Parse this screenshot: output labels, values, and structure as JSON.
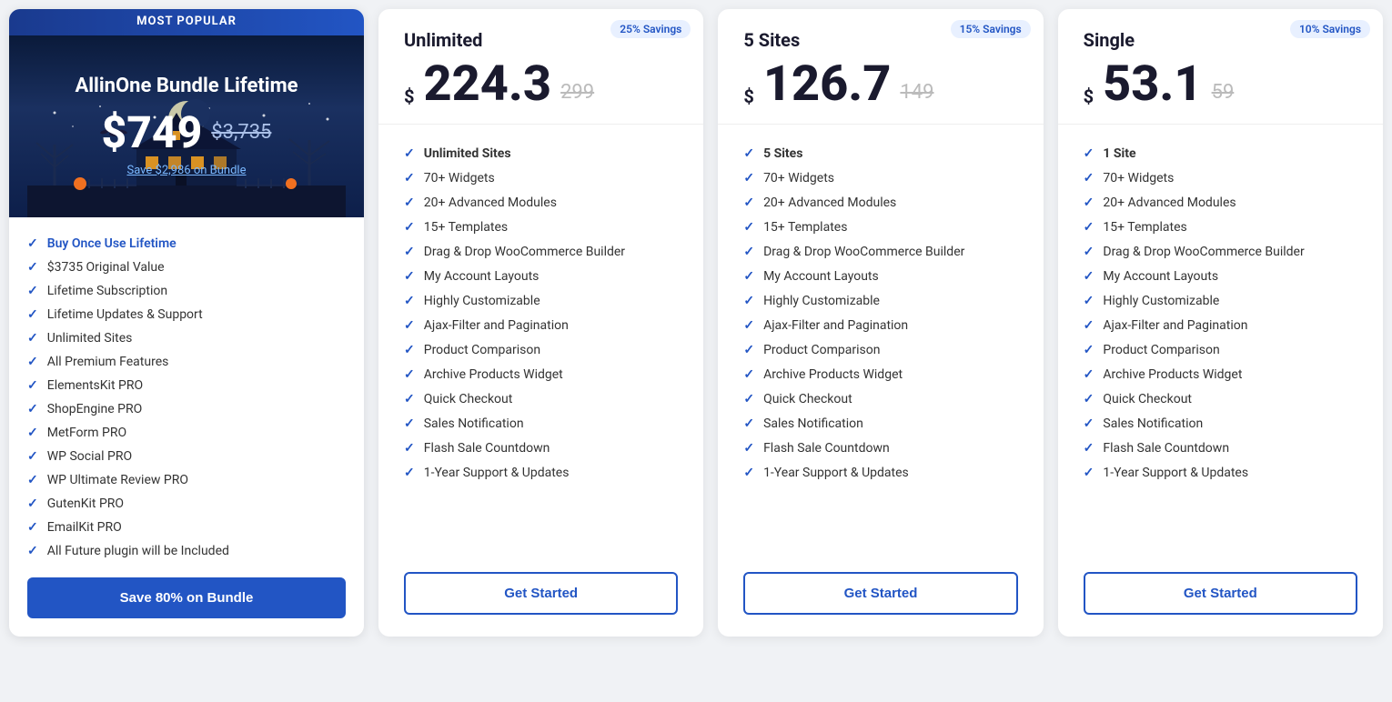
{
  "bundle": {
    "badge": "MOST POPULAR",
    "title": "AllinOne Bundle Lifetime",
    "price": "$749",
    "original_price": "$3,735",
    "save_text": "Save $2,986 on Bundle",
    "features": [
      {
        "text": "Buy Once Use Lifetime",
        "highlight": true
      },
      {
        "text": "$3735 Original Value",
        "highlight": false
      },
      {
        "text": "Lifetime Subscription",
        "highlight": false
      },
      {
        "text": "Lifetime Updates & Support",
        "highlight": false
      },
      {
        "text": "Unlimited Sites",
        "highlight": false
      },
      {
        "text": "All Premium Features",
        "highlight": false
      },
      {
        "text": "ElementsKit PRO",
        "highlight": false
      },
      {
        "text": "ShopEngine PRO",
        "highlight": false
      },
      {
        "text": "MetForm PRO",
        "highlight": false
      },
      {
        "text": "WP Social PRO",
        "highlight": false
      },
      {
        "text": "WP Ultimate Review PRO",
        "highlight": false
      },
      {
        "text": "GutenKit PRO",
        "highlight": false
      },
      {
        "text": "EmailKit PRO",
        "highlight": false
      },
      {
        "text": "All Future plugin will be Included",
        "highlight": false
      }
    ],
    "button_label": "Save 80% on Bundle"
  },
  "plans": [
    {
      "id": "unlimited",
      "savings_badge": "25% Savings",
      "name": "Unlimited",
      "price_dollar": "$",
      "price": "224.3",
      "original_price": "299",
      "features": [
        {
          "text": "Unlimited Sites",
          "bold": true
        },
        {
          "text": "70+ Widgets",
          "bold": false
        },
        {
          "text": "20+ Advanced Modules",
          "bold": false
        },
        {
          "text": "15+ Templates",
          "bold": false
        },
        {
          "text": "Drag & Drop WooCommerce Builder",
          "bold": false
        },
        {
          "text": "My Account Layouts",
          "bold": false
        },
        {
          "text": "Highly Customizable",
          "bold": false
        },
        {
          "text": "Ajax-Filter and Pagination",
          "bold": false
        },
        {
          "text": "Product Comparison",
          "bold": false
        },
        {
          "text": "Archive Products Widget",
          "bold": false
        },
        {
          "text": "Quick Checkout",
          "bold": false
        },
        {
          "text": "Sales Notification",
          "bold": false
        },
        {
          "text": "Flash Sale Countdown",
          "bold": false
        },
        {
          "text": "1-Year Support & Updates",
          "bold": false
        }
      ],
      "button_label": "Get Started"
    },
    {
      "id": "five-sites",
      "savings_badge": "15% Savings",
      "name": "5 Sites",
      "price_dollar": "$",
      "price": "126.7",
      "original_price": "149",
      "features": [
        {
          "text": "5 Sites",
          "bold": true
        },
        {
          "text": "70+ Widgets",
          "bold": false
        },
        {
          "text": "20+ Advanced Modules",
          "bold": false
        },
        {
          "text": "15+ Templates",
          "bold": false
        },
        {
          "text": "Drag & Drop WooCommerce Builder",
          "bold": false
        },
        {
          "text": "My Account Layouts",
          "bold": false
        },
        {
          "text": "Highly Customizable",
          "bold": false
        },
        {
          "text": "Ajax-Filter and Pagination",
          "bold": false
        },
        {
          "text": "Product Comparison",
          "bold": false
        },
        {
          "text": "Archive Products Widget",
          "bold": false
        },
        {
          "text": "Quick Checkout",
          "bold": false
        },
        {
          "text": "Sales Notification",
          "bold": false
        },
        {
          "text": "Flash Sale Countdown",
          "bold": false
        },
        {
          "text": "1-Year Support & Updates",
          "bold": false
        }
      ],
      "button_label": "Get Started"
    },
    {
      "id": "single",
      "savings_badge": "10% Savings",
      "name": "Single",
      "price_dollar": "$",
      "price": "53.1",
      "original_price": "59",
      "features": [
        {
          "text": "1 Site",
          "bold": true
        },
        {
          "text": "70+ Widgets",
          "bold": false
        },
        {
          "text": "20+ Advanced Modules",
          "bold": false
        },
        {
          "text": "15+ Templates",
          "bold": false
        },
        {
          "text": "Drag & Drop WooCommerce Builder",
          "bold": false
        },
        {
          "text": "My Account Layouts",
          "bold": false
        },
        {
          "text": "Highly Customizable",
          "bold": false
        },
        {
          "text": "Ajax-Filter and Pagination",
          "bold": false
        },
        {
          "text": "Product Comparison",
          "bold": false
        },
        {
          "text": "Archive Products Widget",
          "bold": false
        },
        {
          "text": "Quick Checkout",
          "bold": false
        },
        {
          "text": "Sales Notification",
          "bold": false
        },
        {
          "text": "Flash Sale Countdown",
          "bold": false
        },
        {
          "text": "1-Year Support & Updates",
          "bold": false
        }
      ],
      "button_label": "Get Started"
    }
  ],
  "accent_color": "#2255c4",
  "check_symbol": "✓"
}
